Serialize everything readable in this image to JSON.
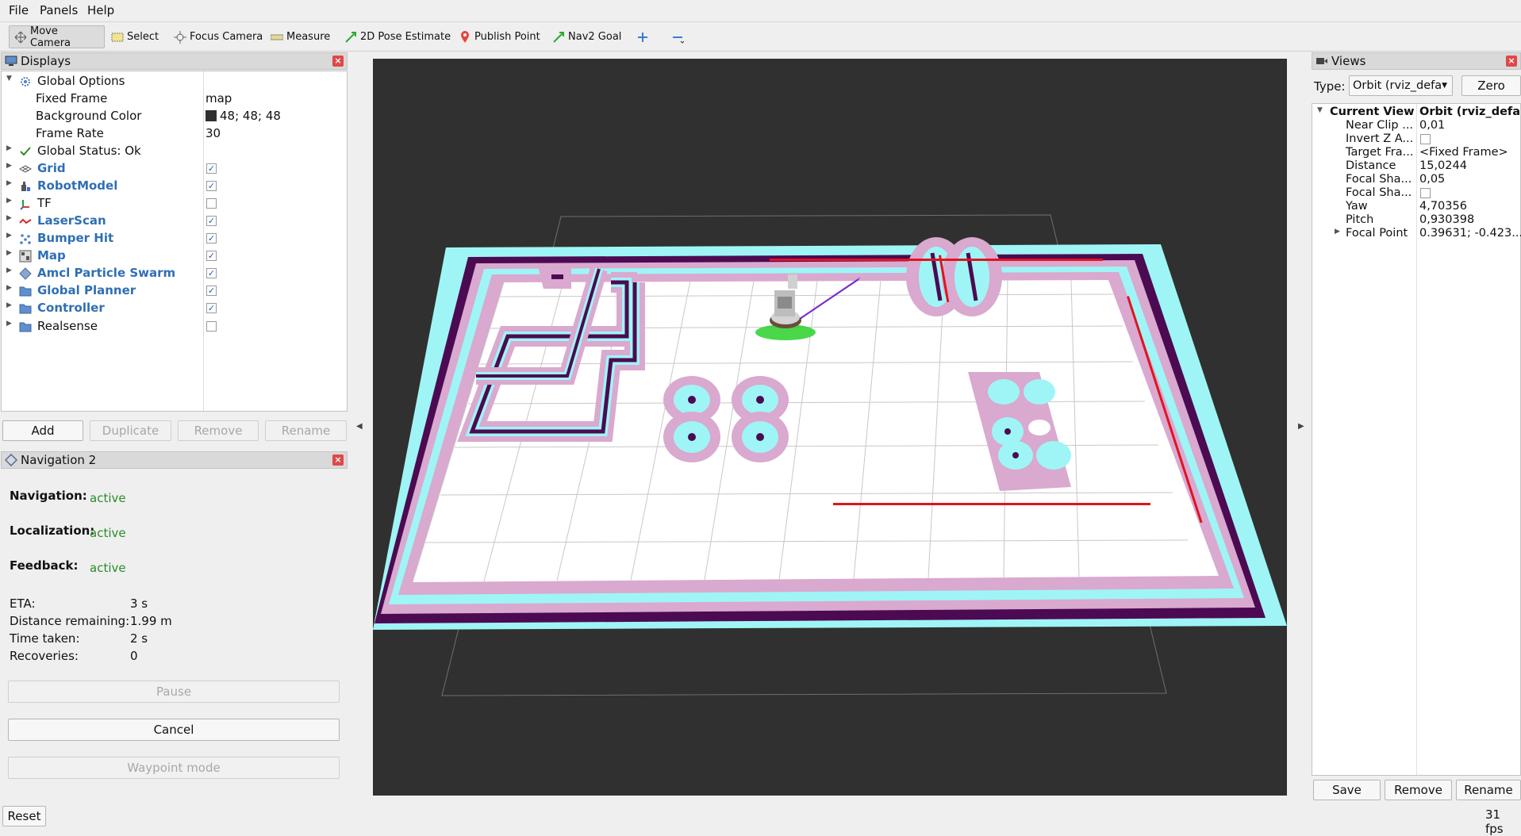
{
  "menu": [
    "File",
    "Panels",
    "Help"
  ],
  "toolbar": {
    "move_camera": "Move Camera",
    "select": "Select",
    "focus_camera": "Focus Camera",
    "measure": "Measure",
    "pose_estimate": "2D Pose Estimate",
    "publish_point": "Publish Point",
    "nav2_goal": "Nav2 Goal"
  },
  "displays": {
    "title": "Displays",
    "rows": [
      {
        "label": "Global Options",
        "value": ""
      },
      {
        "label": "Fixed Frame",
        "value": "map"
      },
      {
        "label": "Background Color",
        "value": "48; 48; 48"
      },
      {
        "label": "Frame Rate",
        "value": "30"
      },
      {
        "label": "Global Status: Ok",
        "value": ""
      },
      {
        "label": "Grid",
        "checked": true
      },
      {
        "label": "RobotModel",
        "checked": true
      },
      {
        "label": "TF",
        "checked": false
      },
      {
        "label": "LaserScan",
        "checked": true
      },
      {
        "label": "Bumper Hit",
        "checked": true
      },
      {
        "label": "Map",
        "checked": true
      },
      {
        "label": "Amcl Particle Swarm",
        "checked": true
      },
      {
        "label": "Global Planner",
        "checked": true
      },
      {
        "label": "Controller",
        "checked": true
      },
      {
        "label": "Realsense",
        "checked": false
      }
    ],
    "buttons": {
      "add": "Add",
      "duplicate": "Duplicate",
      "remove": "Remove",
      "rename": "Rename"
    }
  },
  "navigation": {
    "title": "Navigation 2",
    "navigation_label": "Navigation:",
    "navigation_status": "active",
    "localization_label": "Localization:",
    "localization_status": "active",
    "feedback_label": "Feedback:",
    "feedback_status": "active",
    "eta_label": "ETA:",
    "eta_value": "3 s",
    "distance_label": "Distance remaining:",
    "distance_value": "1.99 m",
    "time_label": "Time taken:",
    "time_value": "2 s",
    "recoveries_label": "Recoveries:",
    "recoveries_value": "0",
    "pause_button": "Pause",
    "cancel_button": "Cancel",
    "waypoint_button": "Waypoint mode"
  },
  "views": {
    "title": "Views",
    "type_label": "Type:",
    "type_value": "Orbit (rviz_defa",
    "zero_button": "Zero",
    "rows": [
      {
        "key": "Current View",
        "value": "Orbit (rviz_defa..."
      },
      {
        "key": "Near Clip ...",
        "value": "0,01"
      },
      {
        "key": "Invert Z A...",
        "value": ""
      },
      {
        "key": "Target Fra...",
        "value": "<Fixed Frame>"
      },
      {
        "key": "Distance",
        "value": "15,0244"
      },
      {
        "key": "Focal Sha...",
        "value": "0,05"
      },
      {
        "key": "Focal Sha...",
        "value": ""
      },
      {
        "key": "Yaw",
        "value": "4,70356"
      },
      {
        "key": "Pitch",
        "value": "0,930398"
      },
      {
        "key": "Focal Point",
        "value": "0.39631; -0.423..."
      }
    ],
    "save_button": "Save",
    "remove_button": "Remove",
    "rename_button": "Rename"
  },
  "footer": {
    "reset_button": "Reset",
    "fps": "31 fps"
  },
  "colors": {
    "viewport_bg": "#303030",
    "cost_cyan": "#9ff5f5",
    "cost_pink": "#d9a9cf",
    "obstacle": "#4c0a52",
    "free": "#ffffff",
    "laser": "#e0141e",
    "particles": "#2ad12a",
    "active_text": "#2a8c2a"
  }
}
